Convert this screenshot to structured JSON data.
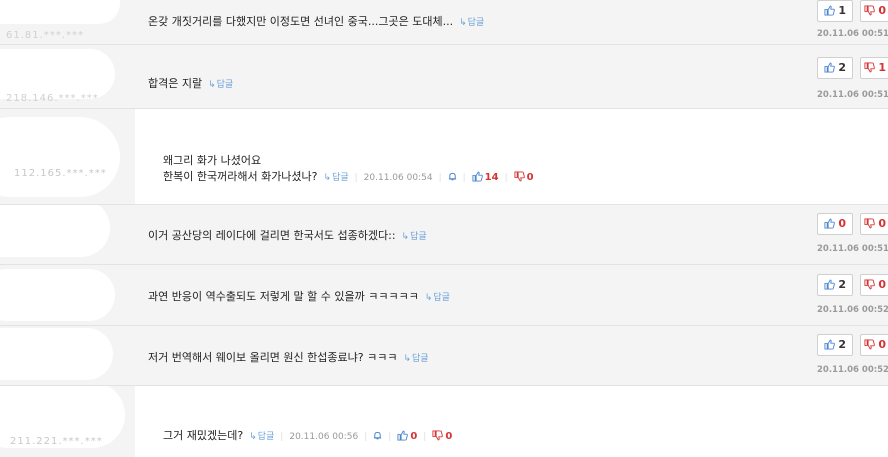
{
  "comments": [
    {
      "ip": "61.81.***.***",
      "text": "온갖 개짓거리를 다했지만 이정도면 선녀인 중국...그곳은 도대체...",
      "reply": "답글",
      "up": "1",
      "down": "0",
      "time": "20.11.06 00:51"
    },
    {
      "ip": "218.146.***.***",
      "text": "합격은 지랄",
      "reply": "답글",
      "up": "2",
      "down": "1",
      "time": "20.11.06 00:51"
    },
    {
      "ip": "112.165.***.***",
      "line1": "왜그리 화가 나셨어요",
      "line2": "한복이 한국꺼라해서 화가나셨나?",
      "reply": "답글",
      "time": "20.11.06 00:54",
      "up": "14",
      "down": "0"
    },
    {
      "ip": "",
      "text": "이거 공산당의 레이다에 걸리면 한국서도 섭종하겠다::",
      "reply": "답글",
      "up": "0",
      "down": "0",
      "time": "20.11.06 00:51"
    },
    {
      "ip": "",
      "text": "과연 반응이 역수출되도 저렇게 말 할 수 있을까 ㅋㅋㅋㅋㅋ",
      "reply": "답글",
      "up": "2",
      "down": "0",
      "time": "20.11.06 00:52"
    },
    {
      "ip": "",
      "text": "저거 번역해서 웨이보 올리면 원신 한섭종료냐? ㅋㅋㅋ",
      "reply": "답글",
      "up": "2",
      "down": "0",
      "time": "20.11.06 00:52"
    },
    {
      "ip": "211.221.***.***",
      "text": "그거 재밌겠는데?",
      "reply": "답글",
      "time": "20.11.06 00:56",
      "up": "0",
      "down": "0"
    }
  ],
  "icons": {
    "like": "thumbs-up-icon",
    "dislike": "thumbs-down-icon",
    "report": "bell-icon",
    "reply": "reply-arrow-icon"
  },
  "colors": {
    "accent_blue": "#4a86cf",
    "accent_red": "#d63333",
    "reply_blue": "#6aa0d8"
  }
}
